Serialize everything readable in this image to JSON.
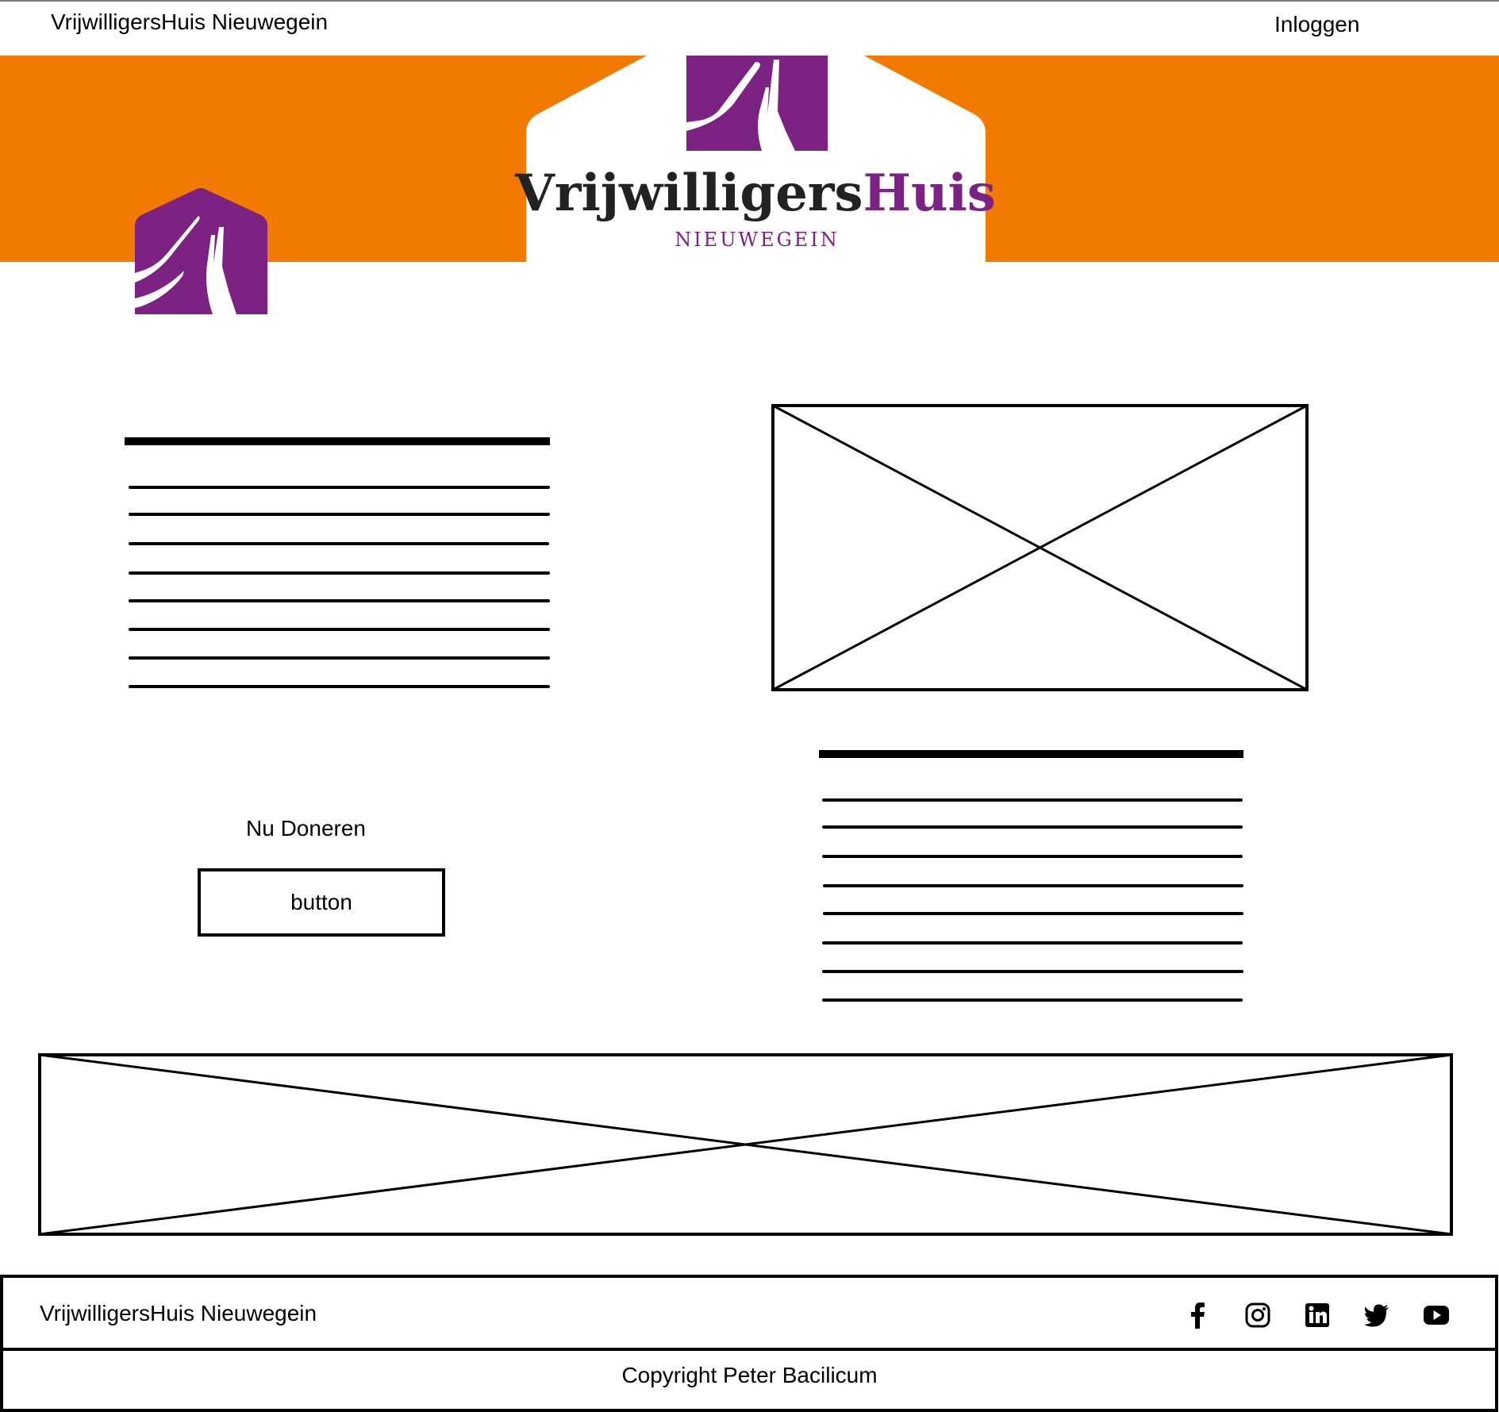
{
  "header": {
    "site_title": "VrijwilligersHuis Nieuwegein",
    "login_label": "Inloggen"
  },
  "banner": {
    "logo_wordmark_dark": "Vrijwilligers",
    "logo_wordmark_accent": "Huis",
    "logo_subtitle": "NIEUWEGEIN"
  },
  "colors": {
    "banner_orange": "#F27A02",
    "brand_purple": "#7B2283",
    "wordmark_dark": "#222222"
  },
  "donate": {
    "label": "Nu Doneren",
    "button_label": "button"
  },
  "footer": {
    "site_name": "VrijwilligersHuis Nieuwegein",
    "copyright": "Copyright Peter Bacilicum",
    "social_icons": [
      "facebook-icon",
      "instagram-icon",
      "linkedin-icon",
      "twitter-icon",
      "youtube-icon"
    ]
  }
}
